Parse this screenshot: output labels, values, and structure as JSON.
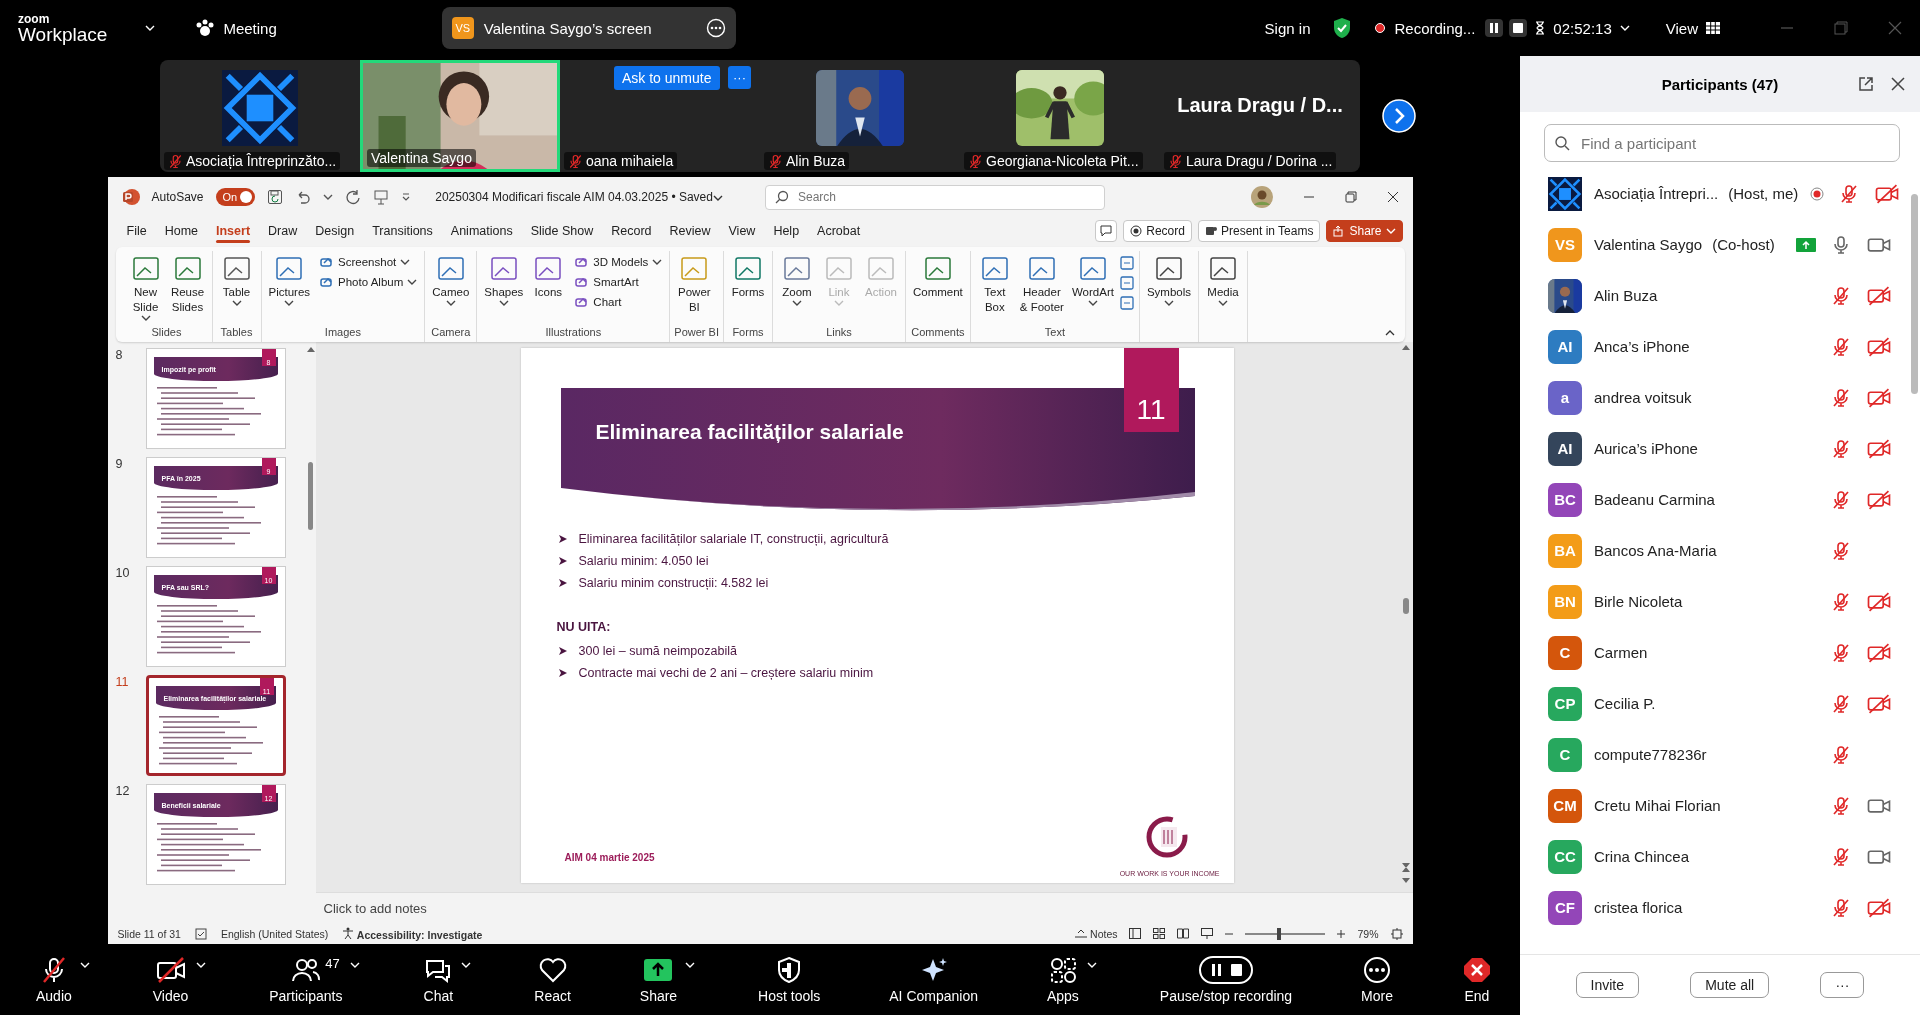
{
  "topbar": {
    "logo_top": "zoom",
    "logo_bottom": "Workplace",
    "meeting_label": "Meeting",
    "share_badge": "VS",
    "share_title": "Valentina Saygo’s screen",
    "sign_in": "Sign in",
    "recording": "Recording...",
    "timer": "02:52:13",
    "view": "View"
  },
  "video_strip": [
    {
      "kind": "logo",
      "name": "Asociația Întreprinzăto...",
      "muted": true,
      "speaking": false
    },
    {
      "kind": "picture",
      "name": "Valentina Saygo",
      "muted": false,
      "speaking": true
    },
    {
      "kind": "blank",
      "name": "oana mihaiela",
      "muted": true,
      "speaking": false,
      "unmute_button": "Ask to unmute",
      "more_button": "···"
    },
    {
      "kind": "picture",
      "name": "Alin Buza",
      "muted": true,
      "speaking": false
    },
    {
      "kind": "picture",
      "name": "Georgiana-Nicoleta Pit...",
      "muted": true,
      "speaking": false
    },
    {
      "kind": "name",
      "name": "Laura Dragu / Dorina ...",
      "display_name": "Laura Dragu / D...",
      "muted": true,
      "speaking": false
    }
  ],
  "powerpoint": {
    "autosave": {
      "label": "AutoSave",
      "on": true,
      "state_text": "On"
    },
    "file_title": "20250304 Modificari fiscale AIM 04.03.2025 • Saved",
    "search_placeholder": "Search",
    "tabs": [
      {
        "label": "File",
        "selected": false
      },
      {
        "label": "Home",
        "selected": false
      },
      {
        "label": "Insert",
        "selected": true
      },
      {
        "label": "Draw",
        "selected": false
      },
      {
        "label": "Design",
        "selected": false
      },
      {
        "label": "Transitions",
        "selected": false
      },
      {
        "label": "Animations",
        "selected": false
      },
      {
        "label": "Slide Show",
        "selected": false
      },
      {
        "label": "Record",
        "selected": false
      },
      {
        "label": "Review",
        "selected": false
      },
      {
        "label": "View",
        "selected": false
      },
      {
        "label": "Help",
        "selected": false
      },
      {
        "label": "Acrobat",
        "selected": false
      }
    ],
    "actions": [
      {
        "label": "Record",
        "kind": "record"
      },
      {
        "label": "Present in Teams",
        "kind": "teams"
      },
      {
        "label": "Share",
        "kind": "share"
      }
    ],
    "ribbon_groups": [
      {
        "label": "Slides",
        "items": [
          {
            "lines": [
              "New",
              "Slide"
            ],
            "kind": "large",
            "menu": true,
            "disabled": false
          },
          {
            "lines": [
              "Reuse",
              "Slides"
            ],
            "kind": "large",
            "menu": false,
            "disabled": false
          }
        ]
      },
      {
        "label": "Tables",
        "items": [
          {
            "label": "Table",
            "kind": "large",
            "menu": true,
            "disabled": false
          }
        ]
      },
      {
        "label": "Images",
        "items": [
          {
            "label": "Pictures",
            "kind": "large",
            "menu": true,
            "disabled": false
          },
          {
            "label": "Screenshot",
            "kind": "small",
            "menu": true,
            "disabled": false
          },
          {
            "label": "Photo Album",
            "kind": "small",
            "menu": true,
            "disabled": false
          }
        ]
      },
      {
        "label": "Camera",
        "items": [
          {
            "label": "Cameo",
            "kind": "large",
            "menu": true,
            "disabled": false
          }
        ]
      },
      {
        "label": "Illustrations",
        "items": [
          {
            "label": "Shapes",
            "kind": "large",
            "menu": true,
            "disabled": false
          },
          {
            "label": "Icons",
            "kind": "large",
            "menu": false,
            "disabled": false
          },
          {
            "label": "3D Models",
            "kind": "small",
            "menu": true,
            "disabled": false
          },
          {
            "label": "SmartArt",
            "kind": "small",
            "menu": false,
            "disabled": false
          },
          {
            "label": "Chart",
            "kind": "small",
            "menu": false,
            "disabled": false
          }
        ]
      },
      {
        "label": "Power BI",
        "items": [
          {
            "lines": [
              "Power",
              "BI"
            ],
            "kind": "large",
            "menu": false,
            "disabled": false
          }
        ]
      },
      {
        "label": "Forms",
        "items": [
          {
            "label": "Forms",
            "kind": "large",
            "menu": false,
            "disabled": false
          }
        ]
      },
      {
        "label": "Links",
        "items": [
          {
            "label": "Zoom",
            "kind": "large",
            "menu": true,
            "disabled": false
          },
          {
            "label": "Link",
            "kind": "large",
            "menu": true,
            "disabled": true
          },
          {
            "label": "Action",
            "kind": "large",
            "menu": false,
            "disabled": true
          }
        ]
      },
      {
        "label": "Comments",
        "items": [
          {
            "label": "Comment",
            "kind": "large",
            "menu": false,
            "disabled": false
          }
        ]
      },
      {
        "label": "Text",
        "items": [
          {
            "lines": [
              "Text",
              "Box"
            ],
            "kind": "large",
            "menu": false,
            "disabled": false
          },
          {
            "lines": [
              "Header",
              "& Footer"
            ],
            "kind": "large",
            "menu": false,
            "disabled": false
          },
          {
            "label": "WordArt",
            "kind": "large",
            "menu": true,
            "disabled": false
          },
          {
            "kind": "icons"
          }
        ]
      },
      {
        "items": [
          {
            "label": "Symbols",
            "kind": "large",
            "menu": true,
            "disabled": false
          }
        ]
      },
      {
        "items": [
          {
            "label": "Media",
            "kind": "large",
            "menu": true,
            "disabled": false
          }
        ]
      }
    ],
    "thumbnails": [
      {
        "number": "8",
        "badge": "8",
        "title": "Impozit pe profit",
        "selected": false
      },
      {
        "number": "9",
        "badge": "9",
        "title": "PFA în 2025",
        "selected": false
      },
      {
        "number": "10",
        "badge": "10",
        "title": "PFA sau SRL?",
        "selected": false
      },
      {
        "number": "11",
        "badge": "11",
        "title": "Eliminarea facilităților salariale",
        "selected": true
      },
      {
        "number": "12",
        "badge": "12",
        "title": "Beneficii salariale",
        "selected": false
      }
    ],
    "slide": {
      "number": "11",
      "title": "Eliminarea facilităților salariale",
      "bullets": [
        "Eliminarea facilităților salariale IT, construcții, agricultură",
        "Salariu minim: 4.050 lei",
        "Salariu minim construcții: 4.582 lei"
      ],
      "heading": "NU UITA:",
      "bullets_2": [
        "300 lei – sumă neimpozabilă",
        "Contracte mai vechi de 2 ani – creștere salariu minim"
      ],
      "footer": "AIM 04 martie 2025",
      "tagline": "OUR WORK IS YOUR INCOME"
    },
    "notes_placeholder": "Click to add notes",
    "status_bar": {
      "slide_counter": "Slide 11 of 31",
      "language": "English (United States)",
      "accessibility": "Accessibility: Investigate",
      "notes": "Notes",
      "level": 0.4,
      "zoom": "79%"
    }
  },
  "participants": {
    "title": "Participants (47)",
    "search_placeholder": "Find a participant",
    "people": [
      {
        "name": "Asociația Întrepri...",
        "role": "(Host, me)",
        "kind": "logo",
        "muted": true,
        "video_on": false,
        "recording": true,
        "sharing": false
      },
      {
        "name": "Valentina Saygo",
        "role": "(Co-host)",
        "kind": "initials",
        "initials": "VS",
        "color": "#f0961c",
        "muted": false,
        "video_on": true,
        "recording": false,
        "sharing": true
      },
      {
        "name": "Alin Buza",
        "muted": true,
        "video_on": false,
        "recording": false,
        "sharing": false
      },
      {
        "name": "Anca’s iPhone",
        "kind": "initials",
        "initials": "AI",
        "color": "#2d7cc1",
        "muted": true,
        "video_on": false,
        "recording": false,
        "sharing": false
      },
      {
        "name": "andrea voitsuk",
        "kind": "initials",
        "initials": "a",
        "color": "#6a64c8",
        "muted": true,
        "video_on": false,
        "recording": false,
        "sharing": false
      },
      {
        "name": "Aurica’s iPhone",
        "kind": "initials",
        "initials": "AI",
        "color": "#34455b",
        "muted": true,
        "video_on": false,
        "recording": false,
        "sharing": false
      },
      {
        "name": "Badeanu Carmina",
        "kind": "initials",
        "initials": "BC",
        "color": "#9346b8",
        "muted": true,
        "video_on": false,
        "recording": false,
        "sharing": false
      },
      {
        "name": "Bancos Ana-Maria",
        "kind": "initials",
        "initials": "BA",
        "color": "#f39c18",
        "muted": true,
        "recording": false,
        "sharing": false
      },
      {
        "name": "Birle Nicoleta",
        "kind": "initials",
        "initials": "BN",
        "color": "#f39c18",
        "muted": true,
        "video_on": false,
        "recording": false,
        "sharing": false
      },
      {
        "name": "Carmen",
        "kind": "initials",
        "initials": "C",
        "color": "#d4560c",
        "muted": true,
        "video_on": false,
        "recording": false,
        "sharing": false
      },
      {
        "name": "Cecilia P.",
        "kind": "initials",
        "initials": "CP",
        "color": "#27a85e",
        "muted": true,
        "video_on": false,
        "recording": false,
        "sharing": false
      },
      {
        "name": "compute778236r",
        "kind": "initials",
        "initials": "C",
        "color": "#27a85e",
        "muted": true,
        "recording": false,
        "sharing": false
      },
      {
        "name": "Cretu Mihai Florian",
        "kind": "initials",
        "initials": "CM",
        "color": "#d4560c",
        "muted": true,
        "video_on": true,
        "recording": false,
        "sharing": false
      },
      {
        "name": "Crina Chincea",
        "kind": "initials",
        "initials": "CC",
        "color": "#27a85e",
        "muted": true,
        "video_on": true,
        "recording": false,
        "sharing": false
      },
      {
        "name": "cristea florica",
        "kind": "initials",
        "initials": "CF",
        "color": "#9346b8",
        "muted": true,
        "video_on": false,
        "recording": false,
        "sharing": false
      }
    ],
    "buttons": [
      "Invite",
      "Mute all",
      "···"
    ]
  },
  "toolbar": [
    {
      "label": "Audio",
      "kind": "audio",
      "off": true,
      "menu": true
    },
    {
      "label": "Video",
      "kind": "video",
      "off": true,
      "menu": true
    },
    {
      "label": "Participants",
      "kind": "participants",
      "count": "47",
      "menu": true
    },
    {
      "label": "Chat",
      "kind": "chat",
      "menu": true
    },
    {
      "label": "React",
      "kind": "react",
      "menu": false
    },
    {
      "label": "Share",
      "kind": "share",
      "menu": true
    },
    {
      "label": "Host tools",
      "kind": "host",
      "menu": false
    },
    {
      "label": "AI Companion",
      "kind": "ai",
      "menu": false
    },
    {
      "label": "Apps",
      "kind": "apps",
      "menu": true
    },
    {
      "label": "Pause/stop recording",
      "kind": "record",
      "menu": false
    },
    {
      "label": "More",
      "kind": "more",
      "menu": false
    },
    {
      "label": "End",
      "kind": "end",
      "menu": false
    }
  ]
}
